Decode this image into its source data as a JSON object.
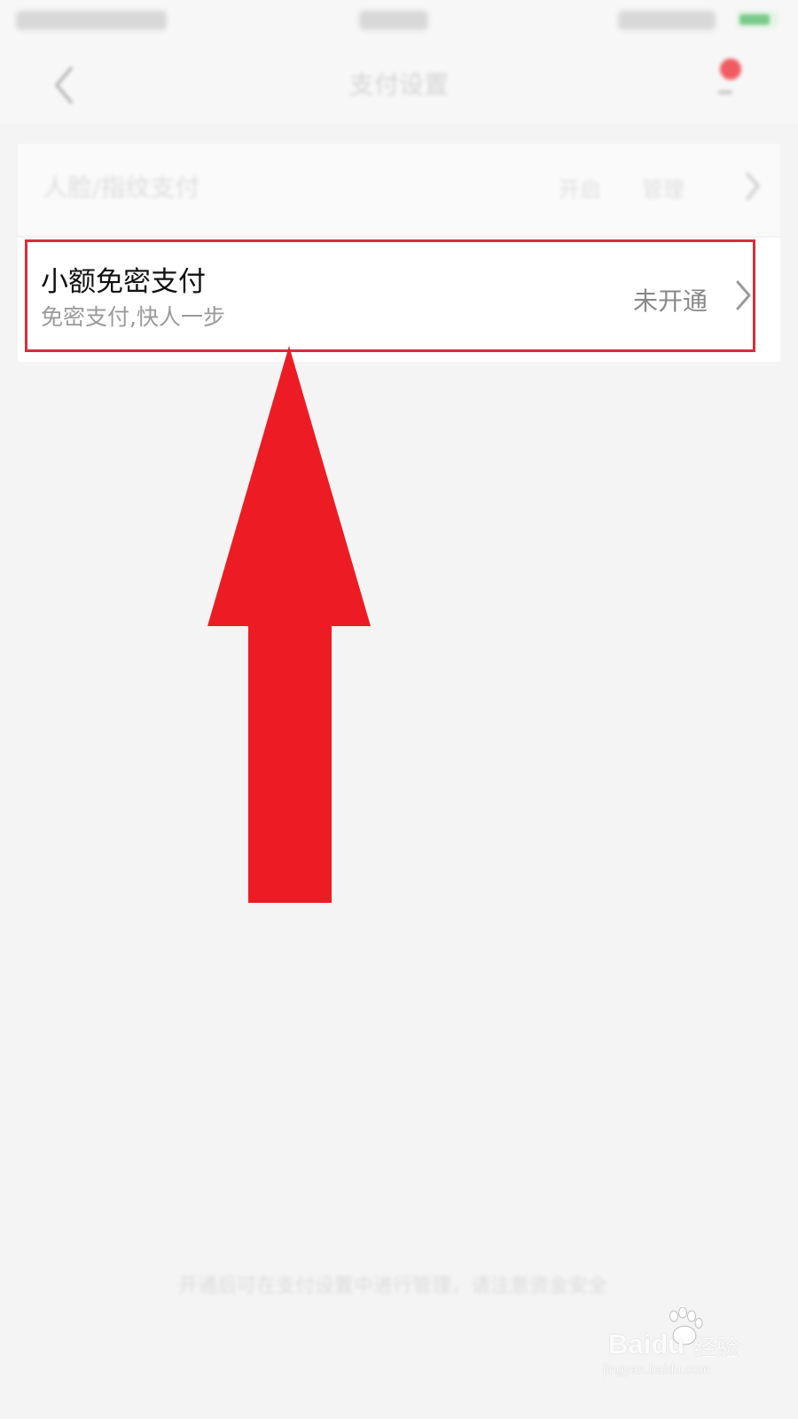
{
  "header": {
    "title": "支付设置"
  },
  "card": {
    "top_row": {
      "title": "人脸/指纹支付",
      "action_1": "开启",
      "action_2": "管理"
    },
    "feature_row": {
      "title": "小额免密支付",
      "subtitle": "免密支付,快人一步",
      "status": "未开通"
    }
  },
  "footer": {
    "note": "开通后可在支付设置中进行管理，请注意资金安全"
  },
  "watermark": {
    "logo": "Baidu",
    "label": "经验",
    "domain": "jingyan.baidu.com"
  },
  "colors": {
    "background": "#f4f4f4",
    "card": "#ffffff",
    "highlight": "#d82d3b",
    "arrow": "#ed1c24",
    "title": "#111111",
    "subtitle": "#9a9a9a"
  },
  "icons": {
    "back": "chevron-left-icon",
    "right": "chevron-right-icon",
    "notification": "notification-icon"
  }
}
